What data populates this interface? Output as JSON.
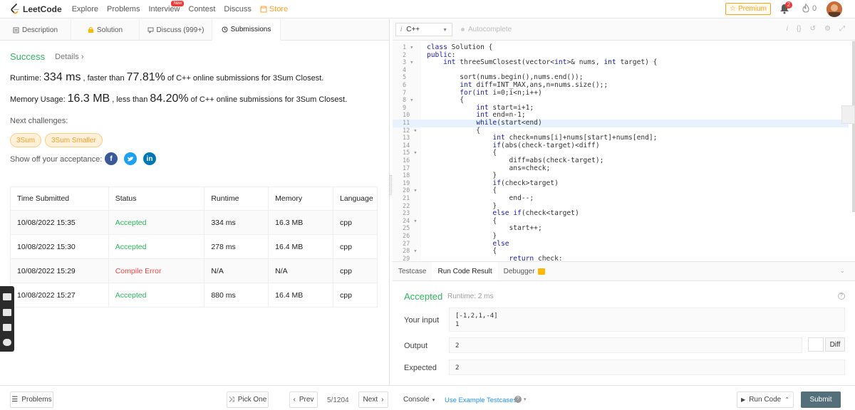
{
  "nav": {
    "brand": "LeetCode",
    "items": [
      "Explore",
      "Problems",
      "Interview",
      "Contest",
      "Discuss"
    ],
    "new_badge": "New",
    "store": "Store",
    "premium": "Premium",
    "notifications": "2",
    "streak": "0"
  },
  "left_tabs": [
    {
      "label": "Description",
      "icon": "document-icon"
    },
    {
      "label": "Solution",
      "icon": "lock-icon"
    },
    {
      "label": "Discuss (999+)",
      "icon": "comment-icon"
    },
    {
      "label": "Submissions",
      "icon": "clock-icon"
    }
  ],
  "result": {
    "status": "Success",
    "details": "Details",
    "runtime_label": "Runtime:",
    "runtime_value": "334 ms",
    "runtime_mid": ", faster than",
    "runtime_pct": "77.81%",
    "runtime_tail": "of C++ online submissions for 3Sum Closest.",
    "memory_label": "Memory Usage:",
    "memory_value": "16.3 MB",
    "memory_mid": ", less than",
    "memory_pct": "84.20%",
    "memory_tail": "of C++ online submissions for 3Sum Closest.",
    "next_label": "Next challenges:",
    "challenges": [
      "3Sum",
      "3Sum Smaller"
    ],
    "share_label": "Show off your acceptance:"
  },
  "submissions": {
    "headers": [
      "Time Submitted",
      "Status",
      "Runtime",
      "Memory",
      "Language"
    ],
    "rows": [
      {
        "time": "10/08/2022 15:35",
        "status": "Accepted",
        "runtime": "334 ms",
        "memory": "16.3 MB",
        "lang": "cpp"
      },
      {
        "time": "10/08/2022 15:30",
        "status": "Accepted",
        "runtime": "278 ms",
        "memory": "16.4 MB",
        "lang": "cpp"
      },
      {
        "time": "10/08/2022 15:29",
        "status": "Compile Error",
        "runtime": "N/A",
        "memory": "N/A",
        "lang": "cpp"
      },
      {
        "time": "10/08/2022 15:27",
        "status": "Accepted",
        "runtime": "880 ms",
        "memory": "16.4 MB",
        "lang": "cpp"
      }
    ]
  },
  "editor": {
    "language": "C++",
    "autocomplete": "Autocomplete",
    "lines": [
      {
        "n": "1",
        "fold": true,
        "text": "class Solution {"
      },
      {
        "n": "2",
        "fold": false,
        "text": "public:"
      },
      {
        "n": "3",
        "fold": true,
        "text": "    int threeSumClosest(vector<int>& nums, int target) {"
      },
      {
        "n": "4",
        "fold": false,
        "text": ""
      },
      {
        "n": "5",
        "fold": false,
        "text": "        sort(nums.begin(),nums.end());"
      },
      {
        "n": "6",
        "fold": false,
        "text": "        int diff=INT_MAX,ans,n=nums.size();;"
      },
      {
        "n": "7",
        "fold": false,
        "text": "        for(int i=0;i<n;i++)"
      },
      {
        "n": "8",
        "fold": true,
        "text": "        {"
      },
      {
        "n": "9",
        "fold": false,
        "text": "            int start=i+1;"
      },
      {
        "n": "10",
        "fold": false,
        "text": "            int end=n-1;"
      },
      {
        "n": "11",
        "fold": false,
        "text": "            while(start<end)"
      },
      {
        "n": "12",
        "fold": true,
        "text": "            {"
      },
      {
        "n": "13",
        "fold": false,
        "text": "                int check=nums[i]+nums[start]+nums[end];"
      },
      {
        "n": "14",
        "fold": false,
        "text": "                if(abs(check-target)<diff)"
      },
      {
        "n": "15",
        "fold": true,
        "text": "                {"
      },
      {
        "n": "16",
        "fold": false,
        "text": "                    diff=abs(check-target);"
      },
      {
        "n": "17",
        "fold": false,
        "text": "                    ans=check;"
      },
      {
        "n": "18",
        "fold": false,
        "text": "                }"
      },
      {
        "n": "19",
        "fold": false,
        "text": "                if(check>target)"
      },
      {
        "n": "20",
        "fold": true,
        "text": "                {"
      },
      {
        "n": "21",
        "fold": false,
        "text": "                    end--;"
      },
      {
        "n": "22",
        "fold": false,
        "text": "                }"
      },
      {
        "n": "23",
        "fold": false,
        "text": "                else if(check<target)"
      },
      {
        "n": "24",
        "fold": true,
        "text": "                {"
      },
      {
        "n": "25",
        "fold": false,
        "text": "                    start++;"
      },
      {
        "n": "26",
        "fold": false,
        "text": "                }"
      },
      {
        "n": "27",
        "fold": false,
        "text": "                else"
      },
      {
        "n": "28",
        "fold": true,
        "text": "                {"
      },
      {
        "n": "29",
        "fold": false,
        "text": "                    return check;"
      }
    ]
  },
  "console": {
    "tabs": [
      "Testcase",
      "Run Code Result",
      "Debugger"
    ],
    "status": "Accepted",
    "runtime": "Runtime: 2 ms",
    "input_label": "Your input",
    "input_value": "[-1,2,1,-4]\n1",
    "output_label": "Output",
    "output_value": "2",
    "expected_label": "Expected",
    "expected_value": "2",
    "diff": "Diff"
  },
  "bottom": {
    "problems": "Problems",
    "pick_one": "Pick One",
    "prev": "Prev",
    "page": "5/1204",
    "next": "Next",
    "console": "Console",
    "use_example": "Use Example Testcases",
    "run_code": "Run Code",
    "submit": "Submit"
  }
}
